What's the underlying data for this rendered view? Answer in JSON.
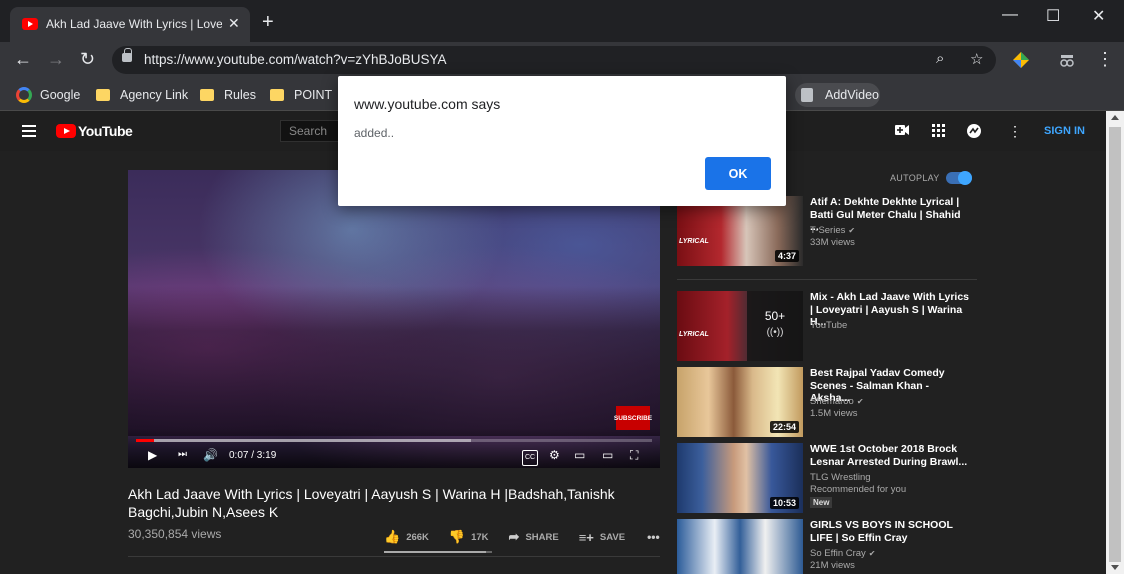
{
  "browser": {
    "tab_title": "Akh Lad Jaave With Lyrics | Loveyatri",
    "tab_close": "✕",
    "new_tab": "+",
    "window_controls": {
      "minimize": "—",
      "maximize": "☐",
      "close": "✕"
    },
    "url": "https://www.youtube.com/watch?v=zYhBJoBUSYA",
    "nav": {
      "back": "←",
      "forward": "→",
      "reload": "↻",
      "menu": "⋮"
    },
    "omni_icons": {
      "zoom": "⌕",
      "star": "☆"
    },
    "bookmarks": [
      {
        "label": "Google",
        "icon": "google-icon"
      },
      {
        "label": "Agency Link",
        "icon": "folder-icon"
      },
      {
        "label": "Rules",
        "icon": "folder-icon"
      },
      {
        "label": "POINT",
        "icon": "folder-icon"
      },
      {
        "label": "AddVideo",
        "icon": "page-icon"
      }
    ]
  },
  "youtube": {
    "logo_text": "YouTube",
    "search_placeholder": "Search",
    "header_icons": {
      "create": "■",
      "apps": "⁙",
      "messages": "➤",
      "more": "⋮"
    },
    "signin": "SIGN IN",
    "player": {
      "current_time": "0:07 / 3:19",
      "played_fraction": 0.035,
      "buffered_fraction": 0.65,
      "watermark": "SUBSCRIBE",
      "controls": {
        "play": "▶",
        "next": "⏭",
        "volume": "🔊",
        "cc": "CC",
        "settings": "⚙",
        "miniplayer": "▭",
        "theater": "▭",
        "fullscreen": "⛶"
      }
    },
    "video": {
      "title": "Akh Lad Jaave With Lyrics | Loveyatri | Aayush S | Warina H |Badshah,Tanishk Bagchi,Jubin N,Asees K",
      "views": "30,350,854 views",
      "likes": "266K",
      "dislikes": "17K",
      "share": "SHARE",
      "save": "SAVE",
      "more": "•••",
      "like_ratio": 0.94
    },
    "sidebar": {
      "autoplay_label": "AUTOPLAY",
      "items": [
        {
          "title": "Atif A: Dekhte Dekhte Lyrical | Batti Gul Meter Chalu | Shahid ...",
          "channel": "T-Series",
          "verified": true,
          "views": "33M views",
          "duration": "4:37"
        },
        {
          "title": "Mix - Akh Lad Jaave With Lyrics | Loveyatri | Aayush S | Warina H...",
          "channel": "YouTube",
          "verified": false,
          "mix_count": "50+",
          "mix_icon": "((•))"
        },
        {
          "title": "Best Rajpal Yadav Comedy Scenes - Salman Khan - Aksha...",
          "channel": "Shemaroo",
          "verified": true,
          "views": "1.5M views",
          "duration": "22:54"
        },
        {
          "title": "WWE 1st October 2018 Brock Lesnar Arrested During Brawl...",
          "channel": "TLG Wrestling",
          "verified": false,
          "views": "Recommended for you",
          "badge": "New",
          "duration": "10:53"
        },
        {
          "title": "GIRLS VS BOYS IN SCHOOL LIFE | So Effin Cray",
          "channel": "So Effin Cray",
          "verified": true,
          "views": "21M views"
        }
      ]
    }
  },
  "dialog": {
    "title": "www.youtube.com says",
    "message": "added..",
    "ok": "OK"
  }
}
